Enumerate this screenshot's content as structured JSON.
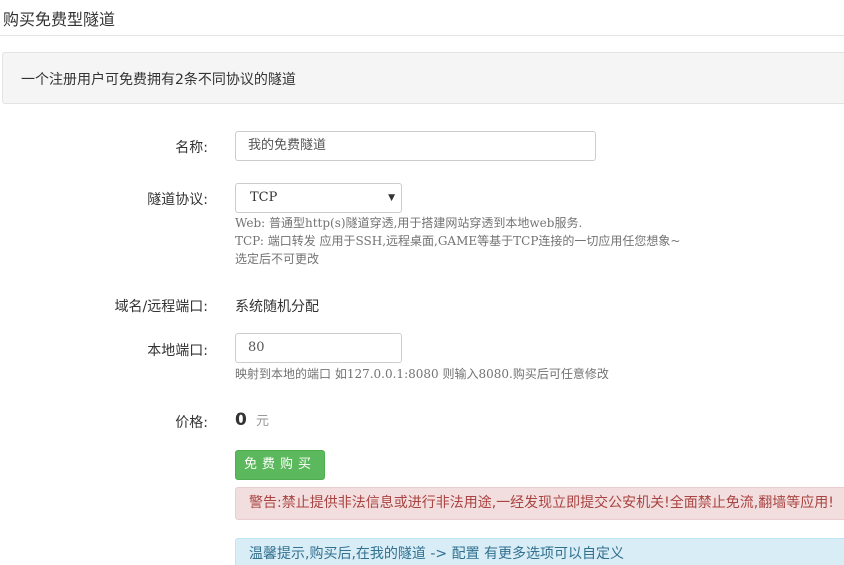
{
  "page": {
    "title": "购买免费型隧道",
    "notice": "一个注册用户可免费拥有2条不同协议的隧道"
  },
  "form": {
    "name": {
      "label": "名称:",
      "value": "我的免费隧道"
    },
    "protocol": {
      "label": "隧道协议:",
      "selected": "TCP",
      "help_lines": [
        "Web: 普通型http(s)隧道穿透,用于搭建网站穿透到本地web服务.",
        "TCP: 端口转发 应用于SSH,远程桌面,GAME等基于TCP连接的一切应用任您想象~",
        "选定后不可更改"
      ]
    },
    "remote": {
      "label": "域名/远程端口:",
      "value": "系统随机分配"
    },
    "local_port": {
      "label": "本地端口:",
      "value": "80",
      "help": "映射到本地的端口 如127.0.0.1:8080 则输入8080.购买后可任意修改"
    },
    "price": {
      "label": "价格:",
      "value": "0",
      "unit": "元"
    },
    "buy_button": "免费购买"
  },
  "alerts": {
    "warning": "警告:禁止提供非法信息或进行非法用途,一经发现立即提交公安机关!全面禁止免流,翻墙等应用!",
    "tip": "温馨提示,购买后,在我的隧道 -> 配置 有更多选项可以自定义"
  },
  "icons": {
    "select_caret": "chevron-down-icon"
  },
  "colors": {
    "buy_button": "#5cb85c",
    "warning_bg": "#f2dede",
    "warning_text": "#a94442",
    "info_bg": "#d9edf7",
    "info_text": "#31708f"
  }
}
